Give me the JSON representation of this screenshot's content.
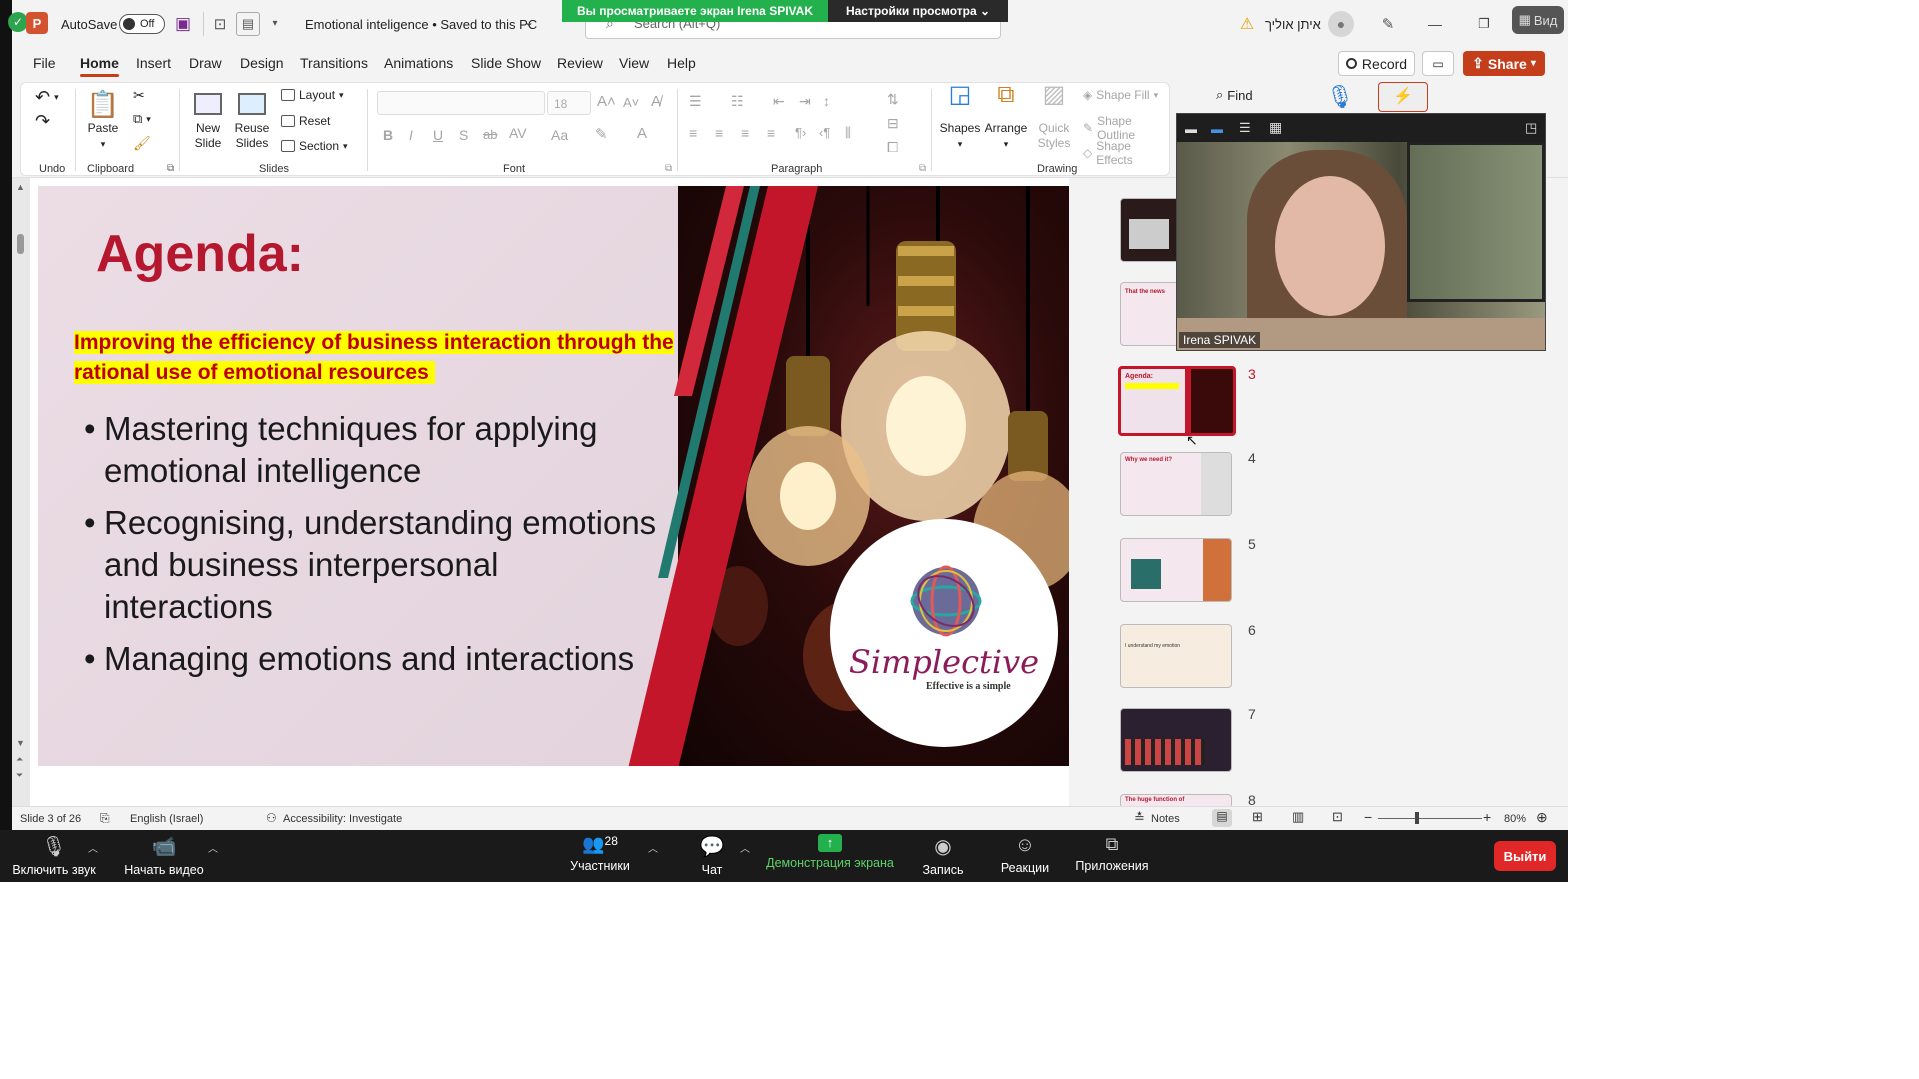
{
  "titlebar": {
    "autosave_label": "AutoSave",
    "autosave_state": "Off",
    "doc_title": "Emotional inteligence • Saved to this PC",
    "search_placeholder": "Search (Alt+Q)",
    "user_name": "איתן אוליך",
    "zoom_banner": "Вы просматриваете экран Irena SPIVAK",
    "zoom_view_options": "Настройки просмотра",
    "corner_text": "Вид"
  },
  "menu": {
    "tabs": [
      "File",
      "Home",
      "Insert",
      "Draw",
      "Design",
      "Transitions",
      "Animations",
      "Slide Show",
      "Review",
      "View",
      "Help"
    ],
    "record_label": "Record",
    "share_label": "Share"
  },
  "ribbon": {
    "undo_group": "Undo",
    "clipboard_group": "Clipboard",
    "paste_label": "Paste",
    "slides_group": "Slides",
    "new_slide_label": "New Slide",
    "reuse_slides_label": "Reuse Slides",
    "layout_label": "Layout",
    "reset_label": "Reset",
    "section_label": "Section",
    "font_group": "Font",
    "font_size": "18",
    "paragraph_group": "Paragraph",
    "drawing_group": "Drawing",
    "shapes_label": "Shapes",
    "arrange_label": "Arrange",
    "quick_styles_label": "Quick Styles",
    "shape_fill_label": "Shape Fill",
    "shape_outline_label": "Shape Outline",
    "shape_effects_label": "Shape Effects",
    "find_label": "Find"
  },
  "slide": {
    "title": "Agenda:",
    "subtitle": "Improving the efficiency of business interaction through the rational use of emotional resources",
    "bullets": [
      "Mastering techniques for applying emotional intelligence",
      "Recognising, understanding emotions and business interpersonal interactions",
      "Managing emotions and interactions"
    ],
    "logo_name": "Simplective",
    "logo_tagline": "Effective is a simple"
  },
  "thumbnails": {
    "numbers": [
      "3",
      "4",
      "5",
      "6",
      "7",
      "8"
    ],
    "t2_title": "That the news",
    "t3_title": "Agenda:",
    "t4_title": "Why we need it?",
    "t6_text": "I understand my emotion",
    "t8_title": "The huge function of"
  },
  "video": {
    "participant_name": "Irena SPIVAK"
  },
  "statusbar": {
    "slide_info": "Slide 3 of 26",
    "language": "English (Israel)",
    "accessibility": "Accessibility: Investigate",
    "notes_label": "Notes",
    "zoom_level": "80%"
  },
  "zoom_toolbar": {
    "unmute_label": "Включить звук",
    "start_video_label": "Начать видео",
    "participants_label": "Участники",
    "participants_count": "28",
    "chat_label": "Чат",
    "share_screen_label": "Демонстрация экрана",
    "record_label": "Запись",
    "reactions_label": "Реакции",
    "apps_label": "Приложения",
    "leave_label": "Выйти"
  },
  "colors": {
    "accent_red": "#c43e1c",
    "slide_title": "#b5172e",
    "highlight": "#ffff00",
    "share_green": "#22b14c",
    "leave_red": "#e02828"
  }
}
